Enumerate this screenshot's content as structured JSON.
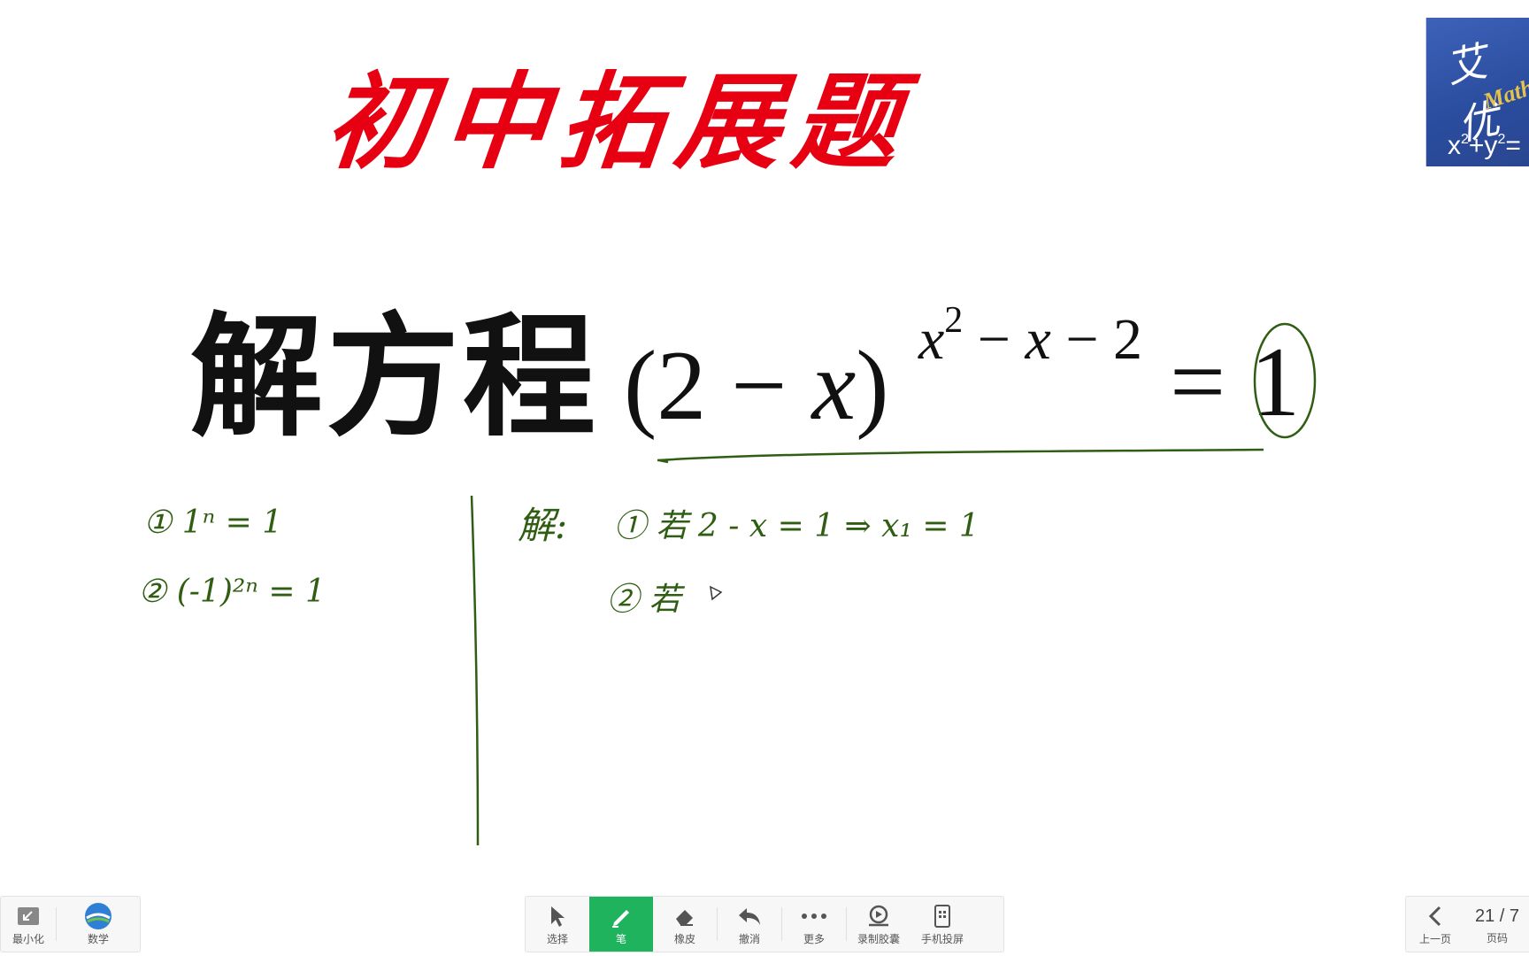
{
  "board": {
    "title": "初中拓展题",
    "equation": {
      "prefix": "解方程",
      "base": "(2 − x)",
      "exponent": "x2 − x − 2",
      "rhs": "= 1"
    },
    "notes": {
      "case1": "① 1ⁿ = 1",
      "case2": "② (-1)²ⁿ = 1",
      "solution_label": "解:",
      "step1": "① 若 2 - x = 1  ⇒  x₁ = 1",
      "step2": "② 若"
    },
    "logo": {
      "cn": "艾优",
      "brand": "Math",
      "formula": "x2+y2="
    }
  },
  "toolbar_left": {
    "minimize_label": "最小化",
    "subject_label": "数学"
  },
  "toolbar_center": {
    "select_label": "选择",
    "pen_label": "笔",
    "eraser_label": "橡皮",
    "undo_label": "撤消",
    "more_label": "更多",
    "record_label": "录制胶囊",
    "phone_cast_label": "手机投屏"
  },
  "toolbar_right": {
    "prev_label": "上一页",
    "page_indicator": "21 / 7",
    "page_label": "页码"
  },
  "colors": {
    "title_red": "#e60012",
    "ink_green": "#2f5e12",
    "active_green": "#1fb35e",
    "logo_blue": "#2a4c9e"
  }
}
